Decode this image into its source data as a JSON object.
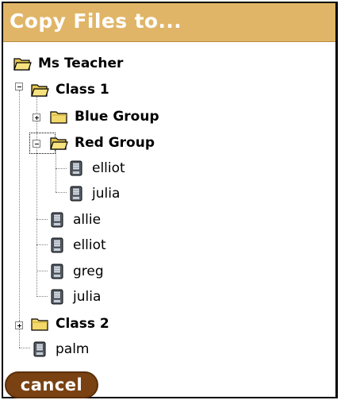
{
  "dialog": {
    "title": "Copy Files to...",
    "cancel_label": "cancel"
  },
  "tree": {
    "root": {
      "label": "Ms Teacher",
      "icon": "open-folder-icon"
    },
    "class1": {
      "label": "Class 1",
      "icon": "open-folder-icon",
      "expanded": true
    },
    "blue_group": {
      "label": "Blue Group",
      "icon": "folder-icon",
      "expanded": false
    },
    "red_group": {
      "label": "Red Group",
      "icon": "open-folder-icon",
      "expanded": true
    },
    "red_members": [
      {
        "label": "elliot",
        "icon": "handheld-device-icon"
      },
      {
        "label": "julia",
        "icon": "handheld-device-icon"
      }
    ],
    "class1_members": [
      {
        "label": "allie",
        "icon": "handheld-device-icon"
      },
      {
        "label": "elliot",
        "icon": "handheld-device-icon"
      },
      {
        "label": "greg",
        "icon": "handheld-device-icon"
      },
      {
        "label": "julia",
        "icon": "handheld-device-icon"
      }
    ],
    "class2": {
      "label": "Class 2",
      "icon": "folder-icon",
      "expanded": false
    },
    "root_members": [
      {
        "label": "palm",
        "icon": "handheld-device-icon"
      }
    ]
  },
  "colors": {
    "header_bg": "#e0b567",
    "header_text": "#ffffff",
    "cancel_bg": "#7a4212",
    "folder_yellow": "#f3d86a"
  }
}
